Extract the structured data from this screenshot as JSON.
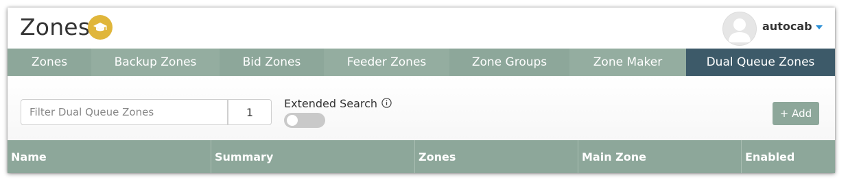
{
  "header": {
    "title": "Zones",
    "badge_icon": "graduation-cap-icon",
    "user": {
      "name": "autocab",
      "avatar_icon": "user-avatar-icon",
      "caret_icon": "caret-down-icon"
    }
  },
  "tabs": [
    {
      "label": "Zones",
      "active": false
    },
    {
      "label": "Backup Zones",
      "active": false
    },
    {
      "label": "Bid Zones",
      "active": false
    },
    {
      "label": "Feeder Zones",
      "active": false
    },
    {
      "label": "Zone Groups",
      "active": false
    },
    {
      "label": "Zone Maker",
      "active": false
    },
    {
      "label": "Dual Queue Zones",
      "active": true
    }
  ],
  "toolbar": {
    "filter_placeholder": "Filter Dual Queue Zones",
    "filter_value": "",
    "count": "1",
    "extended_search_label": "Extended Search",
    "extended_search_enabled": false,
    "info_icon": "info-icon",
    "add_label": "+ Add"
  },
  "table": {
    "columns": [
      "Name",
      "Summary",
      "Zones",
      "Main Zone",
      "Enabled"
    ]
  },
  "colors": {
    "tab_primary": "#8da79a",
    "tab_active": "#3d5a69",
    "badge": "#e0b63b",
    "caret": "#2a8fd6"
  }
}
